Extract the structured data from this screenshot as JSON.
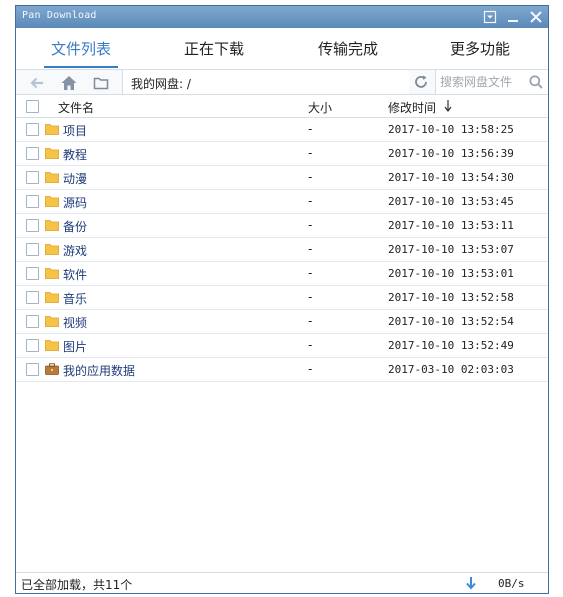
{
  "window": {
    "title": "Pan Download"
  },
  "tabs": [
    {
      "label": "文件列表",
      "active": true
    },
    {
      "label": "正在下载",
      "active": false
    },
    {
      "label": "传输完成",
      "active": false
    },
    {
      "label": "更多功能",
      "active": false
    }
  ],
  "toolbar": {
    "path": "我的网盘: /",
    "search_placeholder": "搜索网盘文件"
  },
  "columns": {
    "name": "文件名",
    "size": "大小",
    "modified": "修改时间"
  },
  "files": [
    {
      "name": "项目",
      "size": "-",
      "modified": "2017-10-10 13:58:25",
      "icon": "folder-icon"
    },
    {
      "name": "教程",
      "size": "-",
      "modified": "2017-10-10 13:56:39",
      "icon": "folder-icon"
    },
    {
      "name": "动漫",
      "size": "-",
      "modified": "2017-10-10 13:54:30",
      "icon": "folder-icon"
    },
    {
      "name": "源码",
      "size": "-",
      "modified": "2017-10-10 13:53:45",
      "icon": "folder-icon"
    },
    {
      "name": "备份",
      "size": "-",
      "modified": "2017-10-10 13:53:11",
      "icon": "folder-icon"
    },
    {
      "name": "游戏",
      "size": "-",
      "modified": "2017-10-10 13:53:07",
      "icon": "folder-icon"
    },
    {
      "name": "软件",
      "size": "-",
      "modified": "2017-10-10 13:53:01",
      "icon": "folder-icon"
    },
    {
      "name": "音乐",
      "size": "-",
      "modified": "2017-10-10 13:52:58",
      "icon": "folder-icon"
    },
    {
      "name": "视频",
      "size": "-",
      "modified": "2017-10-10 13:52:54",
      "icon": "folder-icon"
    },
    {
      "name": "图片",
      "size": "-",
      "modified": "2017-10-10 13:52:49",
      "icon": "folder-icon"
    },
    {
      "name": "我的应用数据",
      "size": "-",
      "modified": "2017-03-10 02:03:03",
      "icon": "briefcase-icon"
    }
  ],
  "status": {
    "text": "已全部加载，共11个",
    "speed": "0B/s"
  },
  "colors": {
    "accent": "#3a7cc4",
    "titlebar": "#6a96c2",
    "folder": "#f5c447",
    "file_name": "#1f3b7a"
  }
}
